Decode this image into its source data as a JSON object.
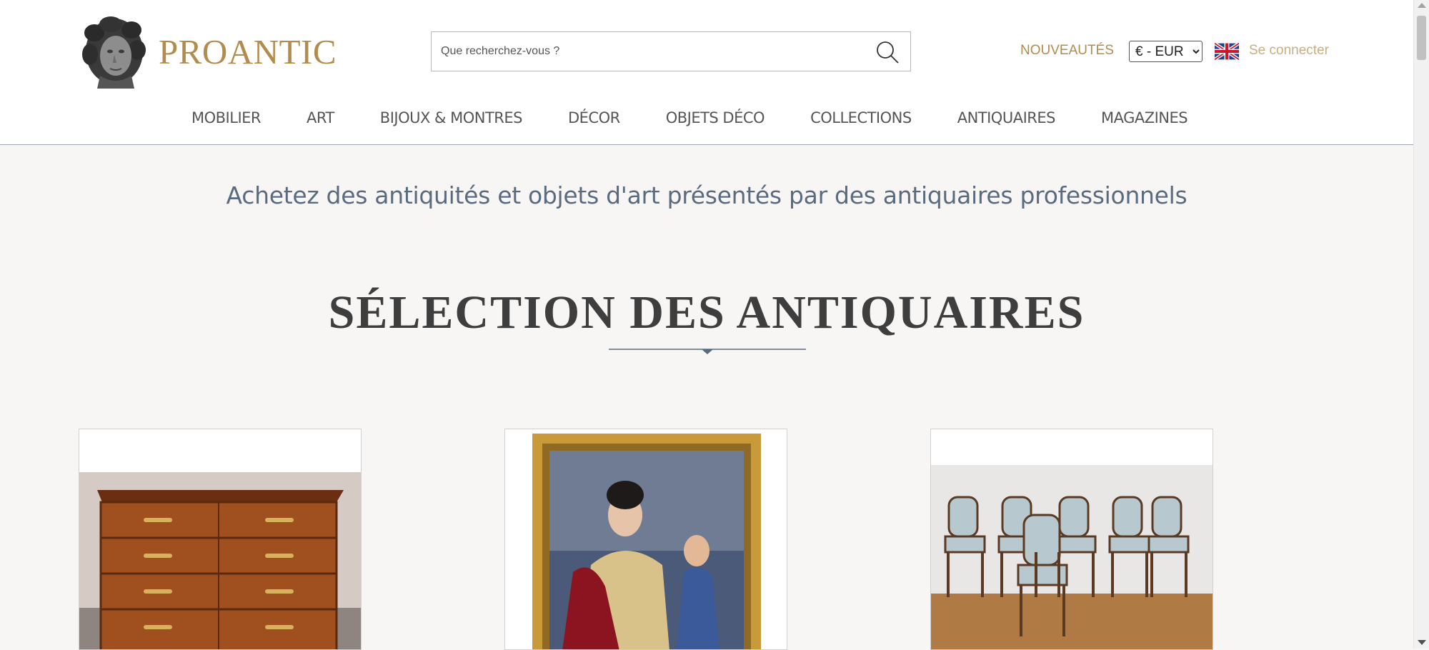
{
  "header": {
    "brand": "PROANTIC",
    "search_placeholder": "Que recherchez-vous ?",
    "nouveautes": "NOUVEAUTÉS",
    "currency": {
      "selected": "€ - EUR",
      "options": [
        "€ - EUR"
      ]
    },
    "language_flag": "uk-flag-icon",
    "login": "Se connecter",
    "nav": [
      "MOBILIER",
      "ART",
      "BIJOUX & MONTRES",
      "DÉCOR",
      "OBJETS DÉCO",
      "COLLECTIONS",
      "ANTIQUAIRES",
      "MAGAZINES"
    ]
  },
  "main": {
    "tagline": "Achetez des antiquités et objets d'art présentés par des antiquaires professionnels",
    "section_title": "SÉLECTION DES ANTIQUAIRES",
    "products": [
      {
        "image": "commode-image"
      },
      {
        "image": "portrait-painting-image"
      },
      {
        "image": "chairs-set-image"
      }
    ]
  },
  "colors": {
    "brand_gold": "#b38b4d",
    "login_gold": "#c9ad83",
    "tagline_blue": "#5a6b80",
    "page_bg": "#f7f6f4"
  }
}
